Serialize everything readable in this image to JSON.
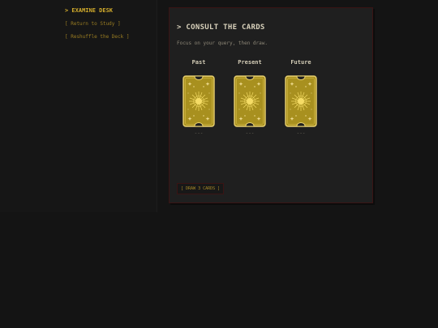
{
  "sidebar": {
    "heading": "> EXAMINE DESK",
    "links": [
      "[ Return to Study ]",
      "[ Reshuffle the Deck ]"
    ]
  },
  "panel": {
    "title": "> CONSULT THE CARDS",
    "subtitle": "Focus on your query, then draw.",
    "slots": [
      {
        "label": "Past",
        "value": "---"
      },
      {
        "label": "Present",
        "value": "---"
      },
      {
        "label": "Future",
        "value": "---"
      }
    ],
    "draw_button": "[ DRAW 3 CARDS ]"
  },
  "colors": {
    "accent": "#d4ad2c",
    "card_face": "#a8901f",
    "card_border": "#e8d070",
    "panel_border": "#3a1414",
    "background": "#141414"
  },
  "icons": [
    "card-back-sun-icon"
  ]
}
